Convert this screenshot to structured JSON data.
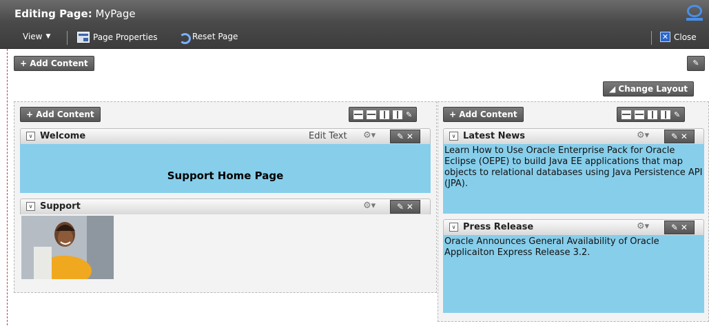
{
  "header": {
    "title_prefix": "Editing Page:",
    "title_page": "MyPage",
    "logo_icon": "oracle-o-icon"
  },
  "toolbar": {
    "view_label": "View",
    "page_properties_label": "Page Properties",
    "reset_page_label": "Reset Page",
    "close_label": "Close"
  },
  "canvas": {
    "add_content_label": "+ Add Content",
    "change_layout_label": "◢ Change Layout"
  },
  "left_column": {
    "add_content_label": "+ Add Content",
    "portlets": [
      {
        "title": "Welcome",
        "edit_text_label": "Edit Text",
        "body_heading": "Support Home Page"
      },
      {
        "title": "Support",
        "image_alt": "support agent photo"
      }
    ]
  },
  "right_column": {
    "add_content_label": "+ Add Content",
    "portlets": [
      {
        "title": "Latest News",
        "body": "Learn How to Use Oracle Enterprise Pack for Oracle Eclipse (OEPE) to build Java EE applications that map objects to relational databases using Java Persistence API (JPA)."
      },
      {
        "title": "Press Release",
        "body": "Oracle Announces General Availability of Oracle Applicaiton Express Release 3.2."
      }
    ]
  },
  "colors": {
    "portlet_body": "#87ceeb",
    "header_bg": "#4a4a4a"
  }
}
